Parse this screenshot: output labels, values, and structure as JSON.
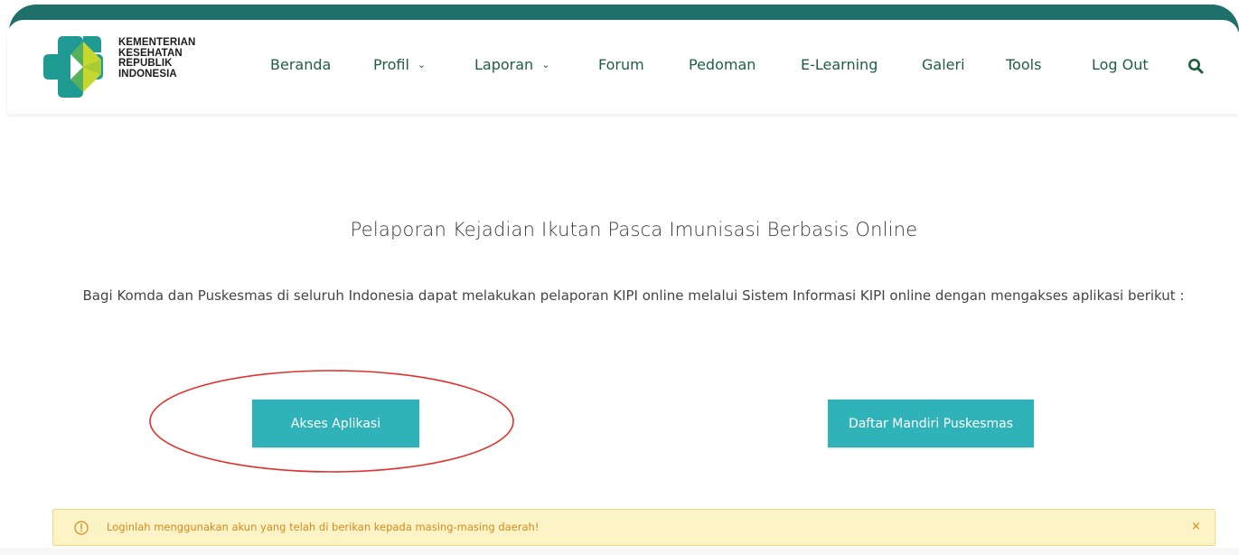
{
  "header": {
    "logo": {
      "lines": [
        "KEMENTERIAN",
        "KESEHATAN",
        "REPUBLIK",
        "INDONESIA"
      ],
      "colors": {
        "teal": "#1e9a92",
        "lime": "#c6d82f",
        "green": "#57b15a"
      }
    },
    "nav": {
      "beranda": "Beranda",
      "profil": "Profil",
      "laporan": "Laporan",
      "forum": "Forum",
      "pedoman": "Pedoman",
      "elearning": "E-Learning",
      "galeri": "Galeri",
      "tools": "Tools",
      "logout": "Log Out"
    },
    "dropdown_icon": "chevron-down-icon",
    "search_icon": "search-icon"
  },
  "main": {
    "title": "Pelaporan Kejadian Ikutan Pasca Imunisasi Berbasis Online",
    "description": "Bagi Komda dan Puskesmas di seluruh Indonesia dapat melakukan pelaporan KIPI online melalui Sistem Informasi KIPI online dengan mengakses aplikasi berikut :",
    "buttons": {
      "akses": "Akses Aplikasi",
      "daftar": "Daftar Mandiri Puskesmas"
    }
  },
  "alert": {
    "icon": "warning-circle-icon",
    "text": "Loginlah menggunakan akun yang telah di berikan kepada masing-masing daerah!",
    "close": "×"
  },
  "colors": {
    "header_band": "#1f6f6a",
    "nav_text": "#1f5f3f",
    "button_bg": "#2fb3b9",
    "alert_bg": "#fcf4c6",
    "alert_text": "#d6891a",
    "annotation": "#e0312b"
  }
}
